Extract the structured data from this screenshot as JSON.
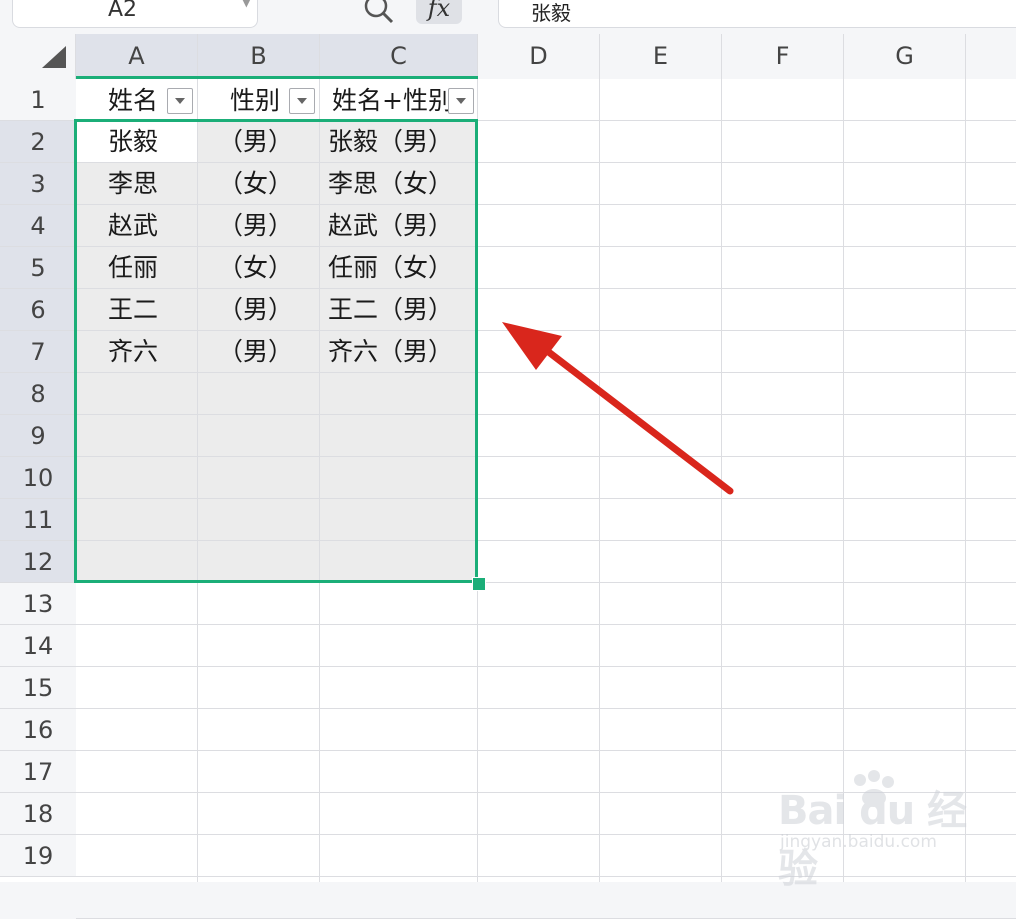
{
  "toolbar": {
    "name_box": "A2",
    "fx_label": "fx",
    "formula_value": "张毅"
  },
  "columns": [
    "A",
    "B",
    "C",
    "D",
    "E",
    "F",
    "G"
  ],
  "rows": [
    "1",
    "2",
    "3",
    "4",
    "5",
    "6",
    "7",
    "8",
    "9",
    "10",
    "11",
    "12",
    "13",
    "14",
    "15",
    "16",
    "17",
    "18",
    "19"
  ],
  "headers": {
    "a": "姓名",
    "b": "性别",
    "c": "姓名+性别"
  },
  "table": [
    {
      "name": "张毅",
      "gender": "（男）",
      "combined": "张毅（男）"
    },
    {
      "name": "李思",
      "gender": "（女）",
      "combined": "李思（女）"
    },
    {
      "name": "赵武",
      "gender": "（男）",
      "combined": "赵武（男）"
    },
    {
      "name": "任丽",
      "gender": "（女）",
      "combined": "任丽（女）"
    },
    {
      "name": "王二",
      "gender": "（男）",
      "combined": "王二（男）"
    },
    {
      "name": "齐六",
      "gender": "（男）",
      "combined": "齐六（男）"
    }
  ],
  "watermark": {
    "brand": "Bai du 经验",
    "url": "jingyan.baidu.com"
  },
  "colors": {
    "selection": "#1bae78",
    "arrow": "#d9261c",
    "header_selected": "#dfe2ea"
  }
}
